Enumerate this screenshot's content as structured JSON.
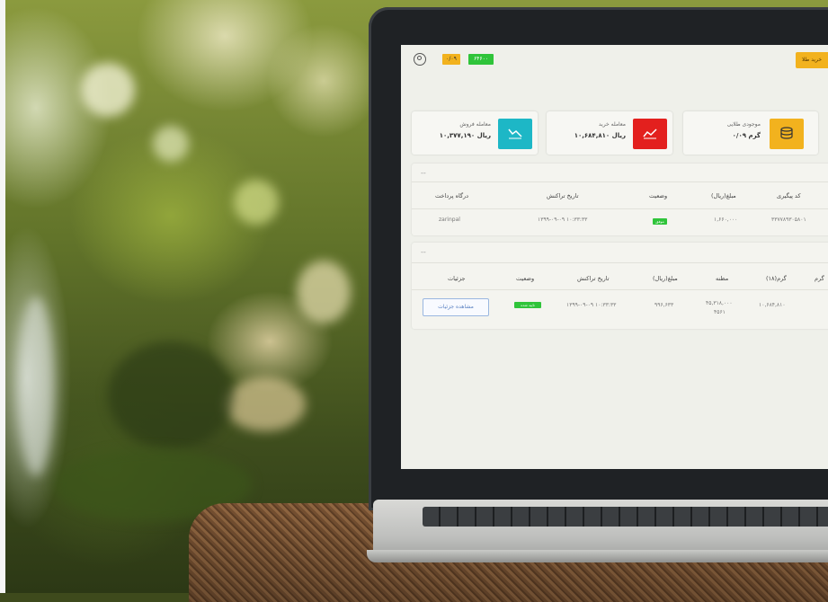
{
  "header": {
    "buy_label": "خرید طلا",
    "gold_chip": "۰/۰۹",
    "green_chip": "۶۴۶۰۰"
  },
  "cards": [
    {
      "label": "موجودی طلایی",
      "value": "۰/۰۹ گرم",
      "color": "#f2b21e",
      "icon": "coins-icon"
    },
    {
      "label": "معامله خرید",
      "value": "۱۰,۶۸۴,۸۱۰ ریال",
      "color": "#e3201e",
      "icon": "chart-up-icon"
    },
    {
      "label": "معامله فروش",
      "value": "۱۰,۳۷۷,۱۹۰ ریال",
      "color": "#1db7c6",
      "icon": "chart-down-icon"
    }
  ],
  "payments": {
    "title": "--",
    "columns": [
      "کد پیگیری",
      "مبلغ(ریال)",
      "وضعیت",
      "تاریخ تراکنش",
      "درگاه پرداخت"
    ],
    "row": {
      "tracking": "۳۳۷۷۸۹۳۰۵۸۰۱",
      "amount": "۱,۶۶۰,۰۰۰",
      "status": "موفق",
      "date": "۱۳۹۹-۰۹-۰۹ ۱۰:۳۳:۳۳",
      "gateway": "zarinpal"
    }
  },
  "orders": {
    "title": "--",
    "columns": [
      "گرم",
      "گرم(۱۸)",
      "مظنه",
      "مبلغ(ریال)",
      "تاریخ تراکنش",
      "وضعیت",
      "جزئیات"
    ],
    "row": {
      "weight18": "۱۰,۶۸۴,۸۱۰",
      "price": "۴۵,۳۱۸,۰۰۰",
      "price_line2": "۴۵۶۱",
      "amount": "۹۹۶,۶۳۳",
      "date": "۱۳۹۹-۰۹-۰۹ ۱۰:۳۳:۳۳",
      "status": "تایید شده",
      "details_label": "مشاهده جزئیات"
    }
  }
}
